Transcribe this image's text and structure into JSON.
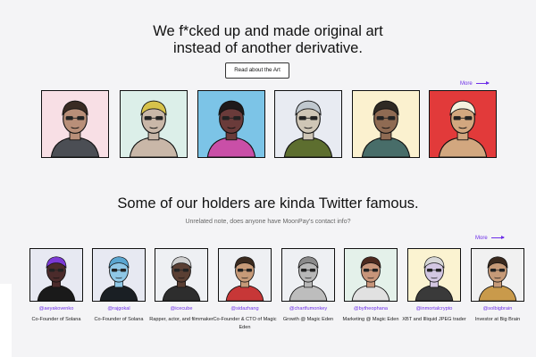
{
  "hero": {
    "title_line1": "We f*cked up and made original art",
    "title_line2": "instead of another derivative.",
    "button_label": "Read about the Art",
    "more_label": "More"
  },
  "art_items": [
    {
      "bg": "#f8dfe5",
      "skin": "#b98f79",
      "shirt": "#4b4e54",
      "hair": "#3a2b23"
    },
    {
      "bg": "#dcefe9",
      "skin": "#c9b7a8",
      "shirt": "#c9b7a8",
      "hair": "#d7c24b"
    },
    {
      "bg": "#7cc4e7",
      "skin": "#6a3b3a",
      "shirt": "#c94fa7",
      "hair": "#1f1a1a"
    },
    {
      "bg": "#e8ebf2",
      "skin": "#cfc6b6",
      "shirt": "#5d6e2f",
      "hair": "#c0c8cf"
    },
    {
      "bg": "#fbf1cf",
      "skin": "#8f6b53",
      "shirt": "#486d69",
      "hair": "#2f2a24"
    },
    {
      "bg": "#e23a3a",
      "skin": "#d2a77f",
      "shirt": "#d2a77f",
      "hair": "#f5f1de"
    }
  ],
  "holders_section": {
    "title": "Some of our holders are kinda Twitter famous.",
    "subtitle": "Unrelated note, does anyone have MoonPay's contact info?",
    "more_label": "More"
  },
  "holders": [
    {
      "handle": "@aeyakovenko",
      "desc": "Co-Founder of Solana",
      "bg": "#e7e9f2",
      "skin": "#4b2b2b",
      "shirt": "#1a1a1a",
      "hair": "#7c3ad6"
    },
    {
      "handle": "@rajgokal",
      "desc": "Co-Founder of Solana",
      "bg": "#e7e9f2",
      "skin": "#8fc7e6",
      "shirt": "#1a1f24",
      "hair": "#5aa6d1"
    },
    {
      "handle": "@icecube",
      "desc": "Rapper, actor, and filmmaker",
      "bg": "#eef0f3",
      "skin": "#5a3f33",
      "shirt": "#2d2d2d",
      "hair": "#d0d0d0"
    },
    {
      "handle": "@sidazhang",
      "desc": "Co-Founder & CTO of Magic Eden",
      "bg": "#eef0f3",
      "skin": "#c69a78",
      "shirt": "#c73737",
      "hair": "#3a2a1f"
    },
    {
      "handle": "@chartfumonkey",
      "desc": "Growth @ Magic Eden",
      "bg": "#eef0f3",
      "skin": "#b7b7b7",
      "shirt": "#bdbdbd",
      "hair": "#8a8a8a"
    },
    {
      "handle": "@bytheophana",
      "desc": "Marketing @ Magic Eden",
      "bg": "#e4f1ea",
      "skin": "#c7957a",
      "shirt": "#e1e1e1",
      "hair": "#4d2a1f"
    },
    {
      "handle": "@inmortalcrypto",
      "desc": "XBT and Illiquid JPEG trader",
      "bg": "#fbf3d1",
      "skin": "#d3c7e2",
      "shirt": "#3a3a3a",
      "hair": "#d7d7d7"
    },
    {
      "handle": "@solbigbrain",
      "desc": "Investor at Big Brain",
      "bg": "#f1f1f1",
      "skin": "#c69a78",
      "shirt": "#c99a4b",
      "hair": "#3a2a1f"
    }
  ]
}
